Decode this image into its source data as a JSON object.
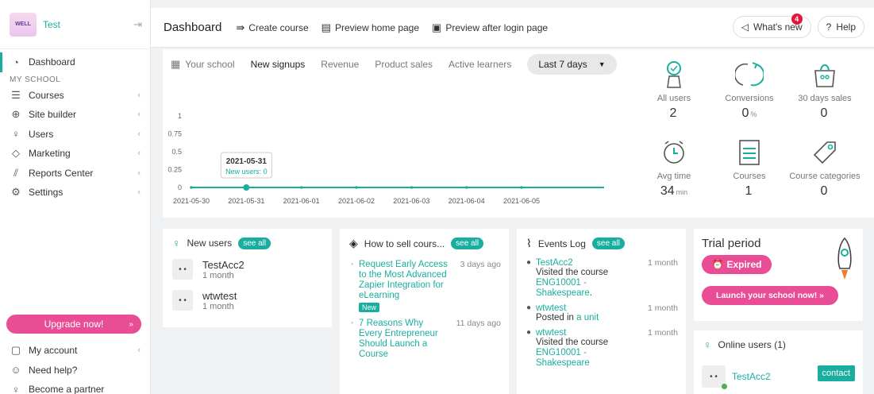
{
  "sidebar": {
    "logo_text": "WELL",
    "school_name": "Test",
    "dashboard": "Dashboard",
    "section_label": "MY SCHOOL",
    "items": [
      {
        "label": "Courses",
        "icon": "courses-icon"
      },
      {
        "label": "Site builder",
        "icon": "globe-icon"
      },
      {
        "label": "Users",
        "icon": "user-icon"
      },
      {
        "label": "Marketing",
        "icon": "tag-icon"
      },
      {
        "label": "Reports Center",
        "icon": "chart-icon"
      },
      {
        "label": "Settings",
        "icon": "gear-icon"
      }
    ],
    "upgrade_label": "Upgrade now!",
    "upgrade_arrow": "»",
    "bottom": [
      {
        "label": "My account"
      },
      {
        "label": "Need help?"
      },
      {
        "label": "Become a partner"
      }
    ]
  },
  "topbar": {
    "title": "Dashboard",
    "create_course": "Create course",
    "preview_home": "Preview home page",
    "preview_after_login": "Preview after login page",
    "whats_new": "What's new",
    "whats_new_badge": "4",
    "help": "Help"
  },
  "tabs": {
    "your_school": "Your school",
    "new_signups": "New signups",
    "revenue": "Revenue",
    "product_sales": "Product sales",
    "active_learners": "Active learners",
    "period": "Last 7 days"
  },
  "chart_data": {
    "type": "line",
    "x": [
      "2021-05-30",
      "2021-05-31",
      "2021-06-01",
      "2021-06-02",
      "2021-06-03",
      "2021-06-04",
      "2021-06-05"
    ],
    "series": [
      {
        "values": [
          0,
          0,
          0,
          0,
          0,
          0,
          0
        ]
      }
    ],
    "yticks": [
      "1",
      "0.75",
      "0.5",
      "0.25",
      "0"
    ],
    "ylim": [
      0,
      1
    ],
    "tooltip": {
      "date": "2021-05-31",
      "text": "New users: 0"
    },
    "color": "#1aaea0"
  },
  "stats": [
    {
      "label": "All users",
      "value": "2",
      "unit": ""
    },
    {
      "label": "Conversions",
      "value": "0",
      "unit": "%"
    },
    {
      "label": "30 days sales",
      "value": "0",
      "unit": ""
    },
    {
      "label": "Avg time",
      "value": "34",
      "unit": "min"
    },
    {
      "label": "Courses",
      "value": "1",
      "unit": ""
    },
    {
      "label": "Course categories",
      "value": "0",
      "unit": ""
    }
  ],
  "new_users": {
    "title": "New users",
    "see_all": "see all",
    "users": [
      {
        "avatar": "• •",
        "name": "TestAcc2",
        "time": "1 month"
      },
      {
        "avatar": "• •",
        "name": "wtwtest",
        "time": "1 month"
      }
    ]
  },
  "how_to_sell": {
    "title": "How to sell cours...",
    "see_all": "see all",
    "posts": [
      {
        "title": "Request Early Access to the Most Advanced Zapier Integration for eLearning",
        "time": "3 days ago",
        "tag": "New"
      },
      {
        "title": "7 Reasons Why Every Entrepreneur Should Launch a Course",
        "time": "11 days ago"
      }
    ]
  },
  "events": {
    "title": "Events Log",
    "see_all": "see all",
    "items": [
      {
        "user": "TestAcc2",
        "text": "Visited the course",
        "link": "ENG10001 - Shakespeare",
        "suffix": ".",
        "time": "1 month"
      },
      {
        "user": "wtwtest",
        "text": "Posted in",
        "link": "a unit",
        "suffix": "",
        "time": "1 month"
      },
      {
        "user": "wtwtest",
        "text": "Visited the course",
        "link": "ENG10001 - Shakespeare",
        "suffix": "",
        "time": "1 month"
      }
    ]
  },
  "trial": {
    "title": "Trial period",
    "expired": "Expired",
    "launch": "Launch your school now! »"
  },
  "online": {
    "title": "Online users (1)",
    "user": "TestAcc2",
    "contact": "contact"
  }
}
